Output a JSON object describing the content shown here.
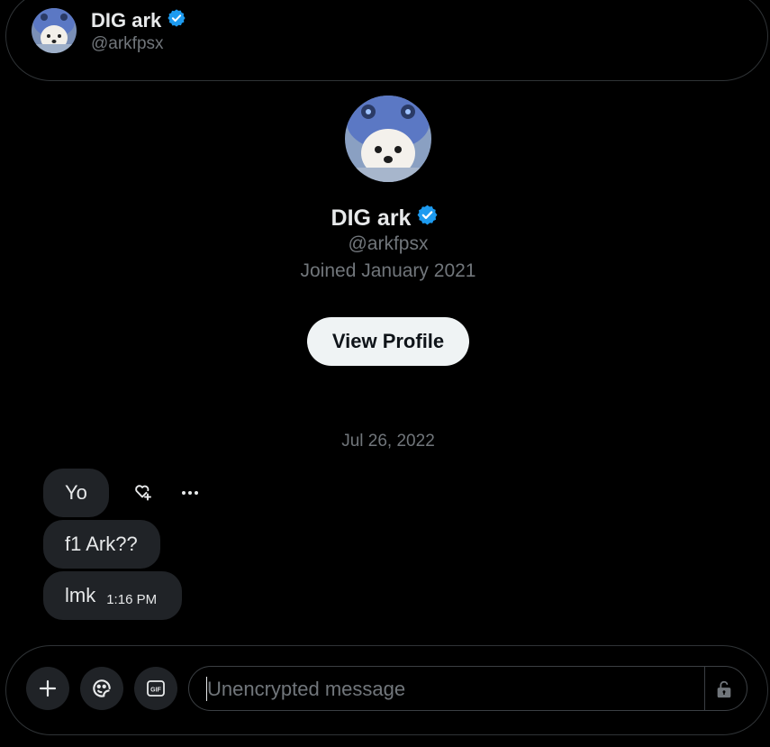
{
  "header": {
    "name": "DIG ark",
    "handle": "@arkfpsx",
    "verified_icon": "verified-badge-icon"
  },
  "profile": {
    "name": "DIG ark",
    "handle": "@arkfpsx",
    "joined": "Joined January 2021",
    "view_profile_label": "View Profile"
  },
  "conversation": {
    "date": "Jul 26, 2022",
    "messages": [
      {
        "text": "Yo"
      },
      {
        "text": "f1 Ark??"
      },
      {
        "text": "lmk",
        "time": "1:16 PM"
      }
    ],
    "actions": {
      "react_icon": "heart-plus-icon",
      "more_icon": "more-horizontal-icon"
    }
  },
  "composer": {
    "placeholder": "Unencrypted message",
    "tools": [
      "plus-icon",
      "emoji-icon",
      "gif-icon"
    ],
    "lock_icon": "unlocked-padlock-icon"
  },
  "colors": {
    "background": "#000000",
    "bubble": "#202327",
    "muted_text": "#71767b",
    "verified_blue": "#1d9bf0",
    "button_bg": "#eff3f4"
  }
}
